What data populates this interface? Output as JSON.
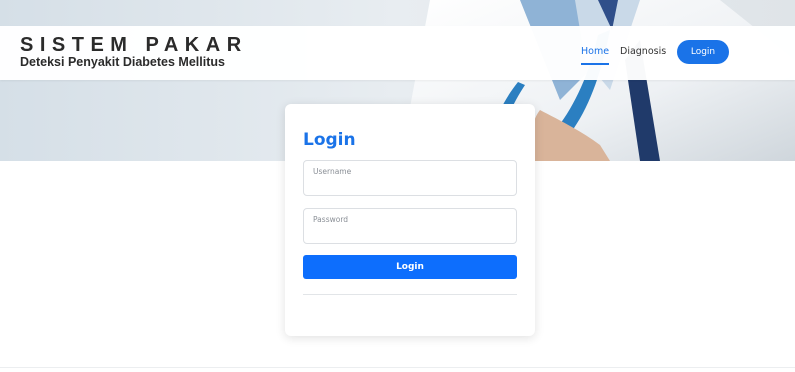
{
  "header": {
    "brand_title": "SISTEM PAKAR",
    "brand_subtitle": "Deteksi Penyakit Diabetes Mellitus"
  },
  "nav": {
    "items": [
      {
        "label": "Home",
        "active": true
      },
      {
        "label": "Diagnosis",
        "active": false
      }
    ],
    "login_label": "Login"
  },
  "login_form": {
    "title": "Login",
    "username_placeholder": "Username",
    "password_placeholder": "Password",
    "submit_label": "Login"
  },
  "colors": {
    "accent": "#1a73e8",
    "button": "#0d6efd",
    "text_dark": "#2b2b2b"
  }
}
